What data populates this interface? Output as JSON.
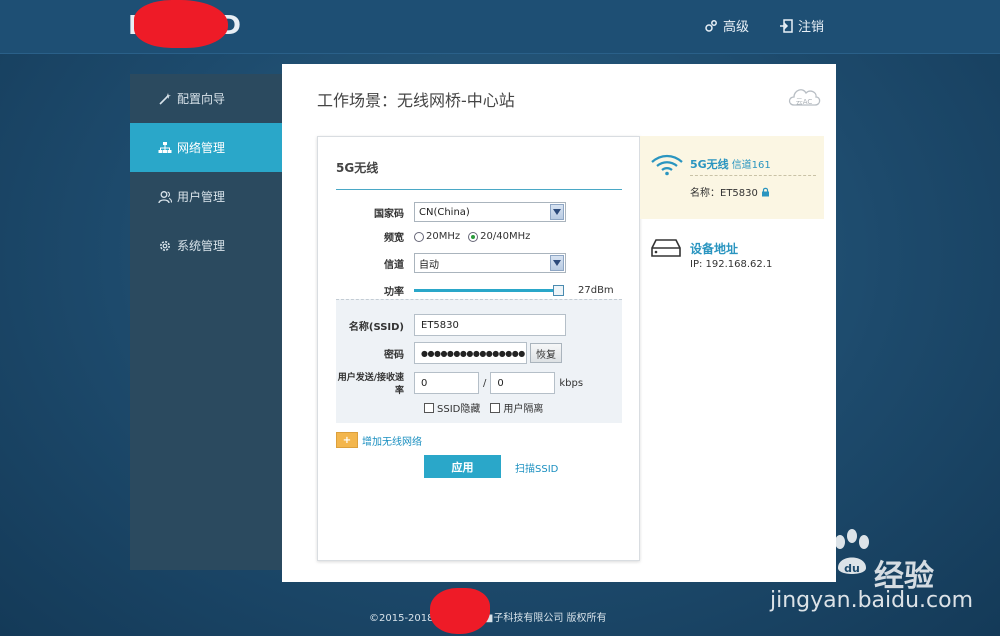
{
  "header": {
    "logo_text": "I■■■D",
    "advanced_label": "高级",
    "logout_label": "注销"
  },
  "sidebar": {
    "items": [
      {
        "label": "配置向导",
        "icon": "magic-wand-icon"
      },
      {
        "label": "网络管理",
        "icon": "network-icon",
        "active": true
      },
      {
        "label": "用户管理",
        "icon": "users-icon"
      },
      {
        "label": "系统管理",
        "icon": "gear-icon"
      }
    ]
  },
  "main": {
    "title": "工作场景：无线网桥-中心站",
    "cloud_badge": "云AC"
  },
  "wireless_form": {
    "title": "5G无线",
    "country_label": "国家码",
    "country_value": "CN(China)",
    "bandwidth_label": "频宽",
    "bandwidth_options": [
      "20MHz",
      "20/40MHz"
    ],
    "bandwidth_selected": "20/40MHz",
    "channel_label": "信道",
    "channel_value": "自动",
    "power_label": "功率",
    "power_value": "27dBm",
    "power_fraction": 1.0,
    "ssid_label": "名称(SSID)",
    "ssid_value": "ET5830",
    "password_label": "密码",
    "password_value": "●●●●●●●●●●●●●●●●",
    "restore_label": "恢复",
    "rate_label": "用户发送/接收速率",
    "send_rate": "0",
    "rate_separator": "/",
    "recv_rate": "0",
    "rate_unit": "kbps",
    "hide_ssid_label": "SSID隐藏",
    "isolation_label": "用户隔离",
    "add_network_label": "增加无线网络",
    "add_button_symbol": "+",
    "apply_label": "应用",
    "scan_label": "扫描SSID"
  },
  "status_panel": {
    "wireless_title": "5G无线",
    "wireless_channel": "信道161",
    "wireless_name": "名称：ET5830",
    "device_title": "设备地址",
    "device_ip": "IP: 192.168.62.1"
  },
  "footer": {
    "copyright": "©2015-2018 ■■■■■■子科技有限公司 版权所有"
  },
  "watermark": {
    "brand": "Bai",
    "brand_suffix": "du",
    "product": "经验",
    "url": "jingyan.baidu.com"
  },
  "colors": {
    "accent": "#2aa7c9",
    "sidebar_bg": "#2b4a5f",
    "active_marker": "#f0a530",
    "info_bg": "#fbf6e3",
    "redaction": "#ee1b27"
  }
}
